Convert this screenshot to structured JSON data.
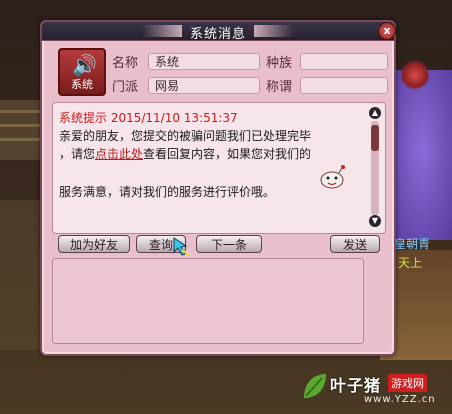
{
  "dialog": {
    "title": "系统消息",
    "close_label": "x"
  },
  "sender": {
    "avatar_label": "系统",
    "name_label": "名称",
    "name_value": "系统",
    "sect_label": "门派",
    "sect_value": "网易",
    "race_label": "种族",
    "race_value": "",
    "title_label": "称谓",
    "title_value": ""
  },
  "message": {
    "header": "系统提示  2015/11/10 13:51:37",
    "line1": "亲爱的朋友，您提交的被骗问题我们已处理完毕",
    "line2_pre": "，请您",
    "line2_link": "点击此处",
    "line2_post": "查看回复内容，如果您对我们的",
    "line3": "服务满意，请对我们的服务进行评价哦。"
  },
  "buttons": {
    "add_friend": "加为好友",
    "query": "查询",
    "next": "下一条",
    "send": "发送"
  },
  "background": {
    "side_text_1": "皇朝青",
    "side_text_2": "天上"
  },
  "watermark": {
    "brand": "叶子猪",
    "badge": "游戏网",
    "url": "www.YZZ.cn"
  },
  "colors": {
    "dialog_bg": "#e9bfcc",
    "header_red": "#d01818",
    "titlebar": "#26202e"
  }
}
